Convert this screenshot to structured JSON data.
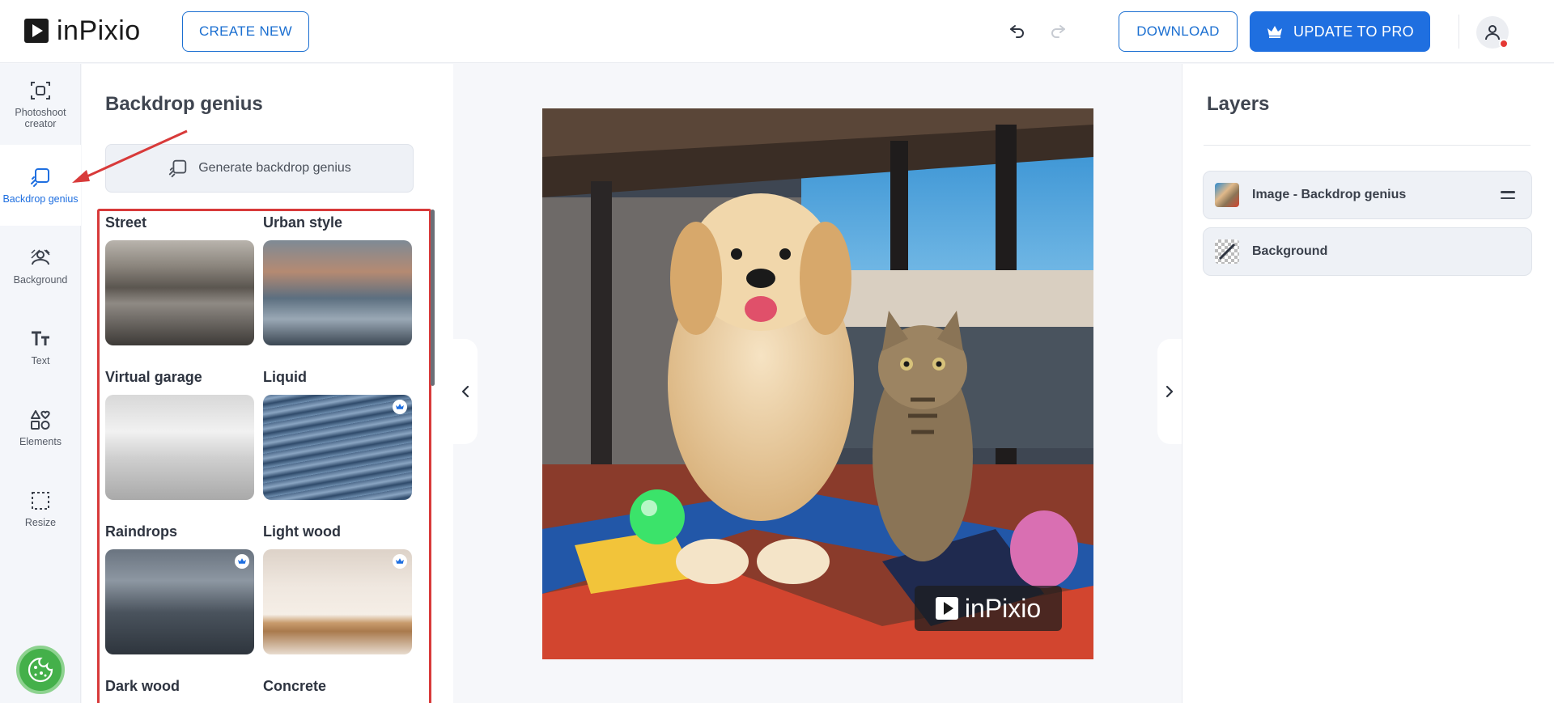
{
  "app": {
    "logo_text": "inPixio"
  },
  "header": {
    "create_label": "CREATE NEW",
    "download_label": "DOWNLOAD",
    "pro_label": "UPDATE TO PRO"
  },
  "rail": {
    "items": [
      {
        "label": "Photoshoot creator",
        "icon": "photoshoot-icon"
      },
      {
        "label": "Backdrop genius",
        "icon": "backdrop-icon",
        "active": true
      },
      {
        "label": "Background",
        "icon": "background-icon"
      },
      {
        "label": "Text",
        "icon": "text-icon"
      },
      {
        "label": "Elements",
        "icon": "elements-icon"
      },
      {
        "label": "Resize",
        "icon": "resize-icon"
      }
    ]
  },
  "panel": {
    "title": "Backdrop genius",
    "generate_label": "Generate backdrop genius",
    "tiles": [
      {
        "name": "Street",
        "pro": false
      },
      {
        "name": "Urban style",
        "pro": false
      },
      {
        "name": "Virtual garage",
        "pro": false
      },
      {
        "name": "Liquid",
        "pro": true
      },
      {
        "name": "Raindrops",
        "pro": true
      },
      {
        "name": "Light wood",
        "pro": true
      },
      {
        "name": "Dark wood",
        "pro": false
      },
      {
        "name": "Concrete",
        "pro": false
      }
    ]
  },
  "canvas": {
    "watermark": "inPixio"
  },
  "layers": {
    "title": "Layers",
    "items": [
      {
        "label": "Image - Backdrop genius"
      },
      {
        "label": "Background"
      }
    ]
  },
  "colors": {
    "accent": "#1f6fe0",
    "highlight_border": "#d83a3a",
    "cookie": "#44b04a"
  }
}
